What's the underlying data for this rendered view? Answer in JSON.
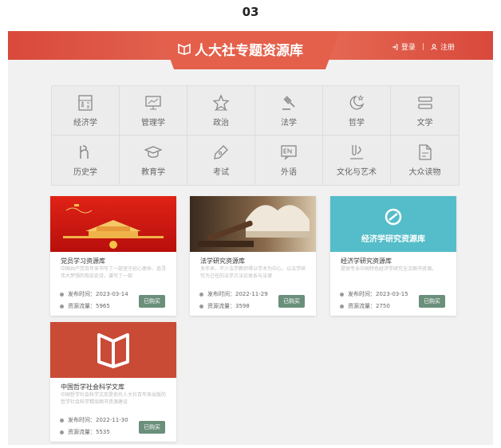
{
  "page_number": "03",
  "header": {
    "title": "人大社专题资源库",
    "login": "登录",
    "separator": "|",
    "register": "注册"
  },
  "subjects": [
    {
      "label": "经济学",
      "icon": "calculator-icon"
    },
    {
      "label": "管理学",
      "icon": "chart-screen-icon"
    },
    {
      "label": "政治",
      "icon": "star-icon"
    },
    {
      "label": "法学",
      "icon": "gavel-icon"
    },
    {
      "label": "哲学",
      "icon": "moon-star-icon"
    },
    {
      "label": "文学",
      "icon": "bars-icon"
    },
    {
      "label": "历史学",
      "icon": "letter-h-icon"
    },
    {
      "label": "教育学",
      "icon": "graduation-cap-icon"
    },
    {
      "label": "考试",
      "icon": "pen-icon"
    },
    {
      "label": "外语",
      "icon": "en-badge-icon"
    },
    {
      "label": "文化与艺术",
      "icon": "brush-icon"
    },
    {
      "label": "大众读物",
      "icon": "document-icon"
    }
  ],
  "cards": [
    {
      "title": "党员学习资源库",
      "desc": "中国共产党百年来书写了一部坚守初心使命、追寻伟大梦想的恢宏史诗，谱写了一部",
      "date_label": "发布时间：",
      "date": "2023-03-14",
      "flow_label": "资源流量：",
      "flow": "5965",
      "button": "已购买"
    },
    {
      "title": "法学研究资源库",
      "desc": "多年来，不少法学教师得以学术为中心，以法学研究为己任的法学方法论体系与法律",
      "date_label": "发布时间：",
      "date": "2022-11-29",
      "flow_label": "资源流量：",
      "flow": "3598",
      "button": "已购买"
    },
    {
      "title": "经济学研究资源库",
      "desc": "提供专业中国特色经济学研究全文图书资源。",
      "date_label": "发布时间：",
      "date": "2023-03-15",
      "flow_label": "资源流量：",
      "flow": "2750",
      "button": "已购买",
      "image_text": "经济学研究资源库"
    },
    {
      "title": "中国哲学社会科学文库",
      "desc": "中国哲学社会科学文库是依托人大社百年来出版的哲学社会科学精品图书资源建设",
      "date_label": "发布时间：",
      "date": "2022-11-30",
      "flow_label": "资源流量：",
      "flow": "5535",
      "button": "已购买"
    }
  ],
  "colors": {
    "header": "#d9493b",
    "buy_button": "#6a8f7b",
    "teal": "#55bdc9",
    "brick": "#c94a35"
  }
}
